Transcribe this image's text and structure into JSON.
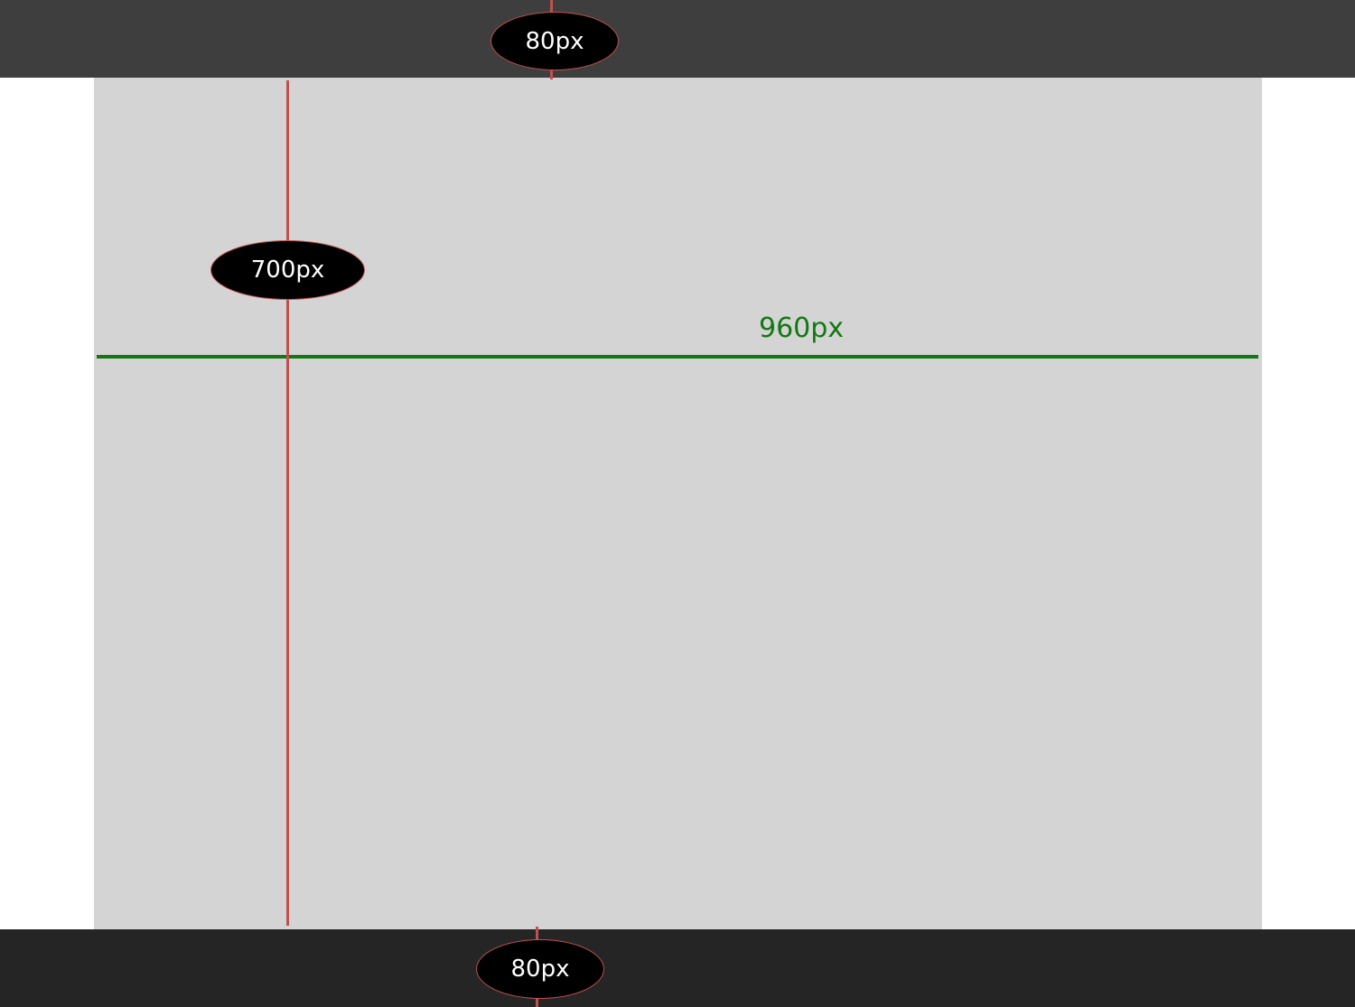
{
  "header": {
    "height_label": "80px"
  },
  "content": {
    "height_label": "700px",
    "width_label": "960px"
  },
  "footer": {
    "height_label": "80px"
  },
  "colors": {
    "header_band": "#3e3e3e",
    "content_area": "#d4d4d4",
    "footer_band": "#252525",
    "height_marker": "#c0504d",
    "width_marker": "#127812",
    "label_pill": "#000000"
  }
}
